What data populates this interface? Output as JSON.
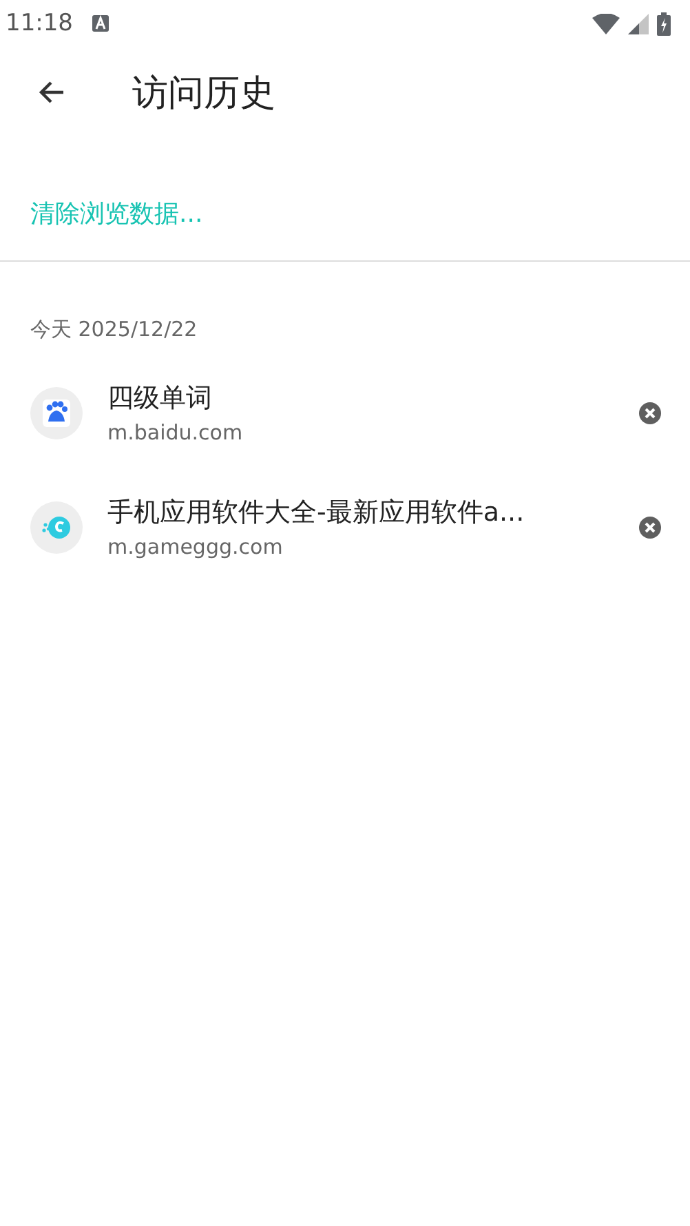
{
  "status_bar": {
    "time": "11:18"
  },
  "header": {
    "title": "访问历史"
  },
  "clear_link": "清除浏览数据...",
  "section": {
    "date_label": "今天 2025/12/22",
    "items": [
      {
        "kind": "paw",
        "title": "四级单词",
        "url": "m.baidu.com"
      },
      {
        "kind": "swirl",
        "title": "手机应用软件大全-最新应用软件a...",
        "url": "m.gameggg.com"
      }
    ]
  }
}
